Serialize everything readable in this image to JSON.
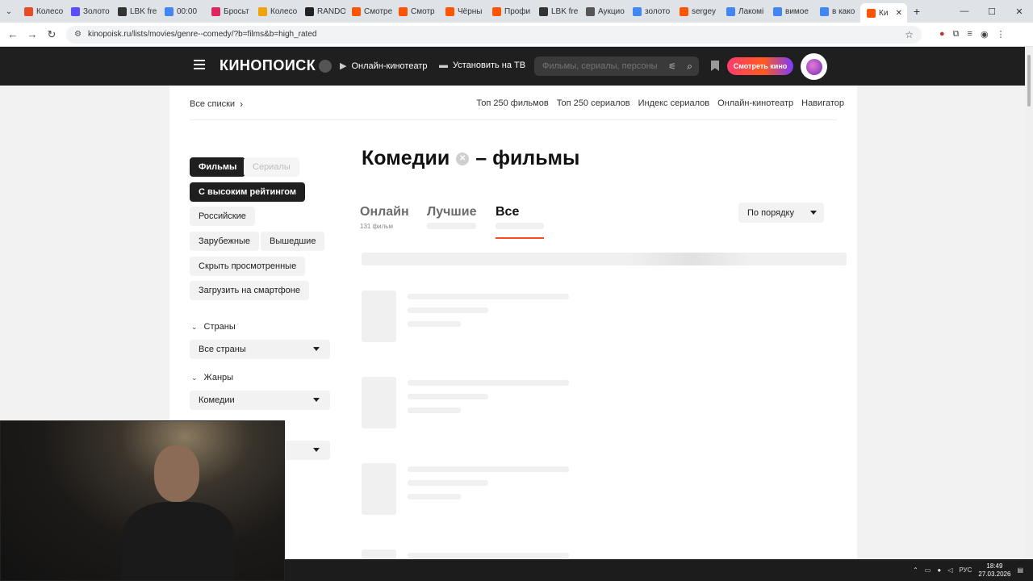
{
  "browser": {
    "tabs": [
      {
        "label": "Колесо",
        "color": "#e44d26"
      },
      {
        "label": "Золото",
        "color": "#5b4cff"
      },
      {
        "label": "LBK fre",
        "color": "#333333"
      },
      {
        "label": "00:00",
        "color": "#4285f4"
      },
      {
        "label": "Бросьт",
        "color": "#e0245e"
      },
      {
        "label": "Колесо",
        "color": "#f0a30a"
      },
      {
        "label": "RANDO",
        "color": "#222222"
      },
      {
        "label": "Смотре",
        "color": "#ff5500"
      },
      {
        "label": "Смотр",
        "color": "#ff5500"
      },
      {
        "label": "Чёрны",
        "color": "#ff5500"
      },
      {
        "label": "Профи",
        "color": "#ff5500"
      },
      {
        "label": "LBK fre",
        "color": "#333333"
      },
      {
        "label": "Аукцио",
        "color": "#555555"
      },
      {
        "label": "золото",
        "color": "#4285f4"
      },
      {
        "label": "sergey",
        "color": "#ff5500"
      },
      {
        "label": "Лакомі",
        "color": "#4285f4"
      },
      {
        "label": "вимое",
        "color": "#4285f4"
      },
      {
        "label": "в како",
        "color": "#4285f4"
      },
      {
        "label": "Ки",
        "color": "#ff5500",
        "active": true
      }
    ],
    "url": "kinopoisk.ru/lists/movies/genre--comedy/?b=films&b=high_rated"
  },
  "header": {
    "logo": "КИНОПОИСК",
    "online_cinema": "Онлайн-кинотеатр",
    "install_tv": "Установить на ТВ",
    "search_placeholder": "Фильмы, сериалы, персоны",
    "watch_button": "Смотреть кино"
  },
  "breadcrumb": {
    "label": "Все списки"
  },
  "topnav": [
    "Топ 250 фильмов",
    "Топ 250 сериалов",
    "Индекс сериалов",
    "Онлайн-кинотеатр",
    "Навигатор"
  ],
  "filters": {
    "chips": {
      "films": "Фильмы",
      "series": "Сериалы",
      "high_rating": "С высоким рейтингом",
      "russian": "Российские",
      "foreign": "Зарубежные",
      "released": "Вышедшие",
      "hide_watched": "Скрыть просмотренные",
      "download": "Загрузить на смартфоне"
    },
    "countries": {
      "heading": "Страны",
      "value": "Все страны"
    },
    "genres": {
      "heading": "Жанры",
      "value": "Комедии"
    }
  },
  "main": {
    "title_genre": "Комедии",
    "title_suffix": "– фильмы",
    "tabs": {
      "online": {
        "label": "Онлайн",
        "count": "131 фильм"
      },
      "best": {
        "label": "Лучшие"
      },
      "all": {
        "label": "Все"
      }
    },
    "sort": "По порядку"
  },
  "taskbar": {
    "lang": "РУС",
    "time": "18:49",
    "date": "27.03.2026"
  }
}
